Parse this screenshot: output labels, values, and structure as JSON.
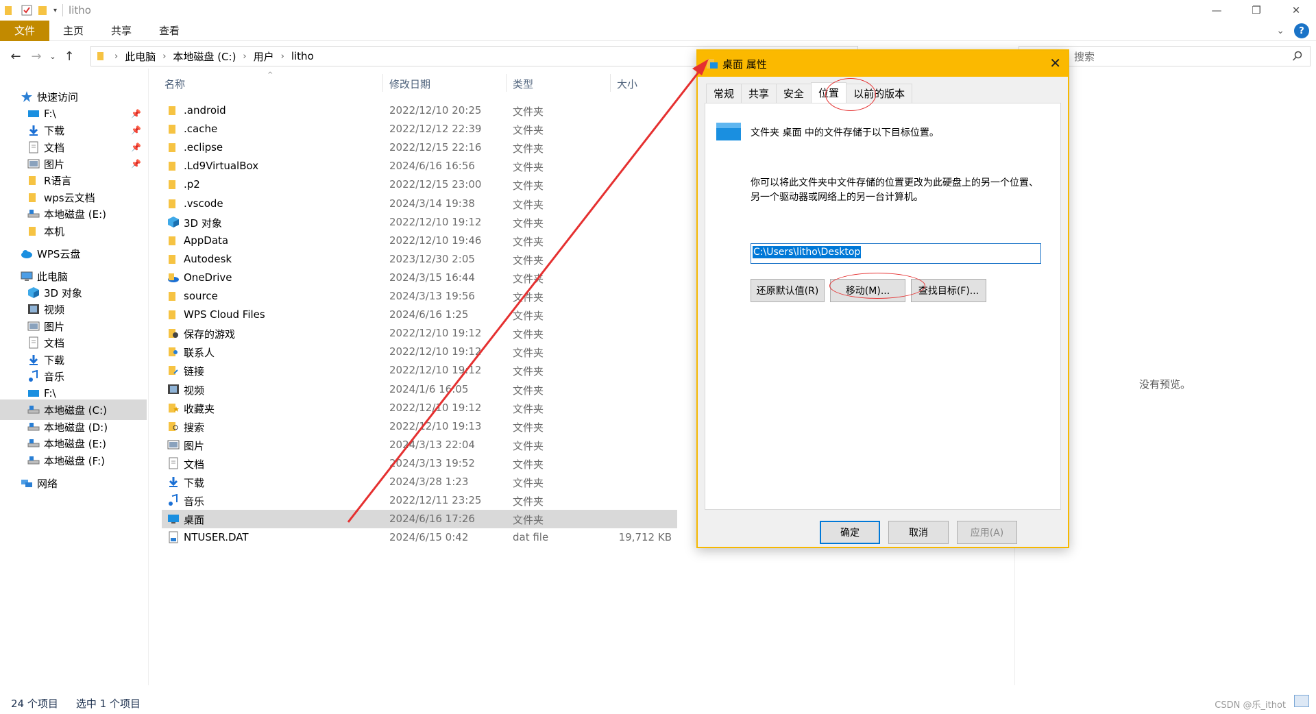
{
  "titlebar": {
    "title": "litho"
  },
  "ribbon": {
    "tabs": [
      "文件",
      "主页",
      "共享",
      "查看"
    ]
  },
  "address": {
    "crumbs": [
      "此电脑",
      "本地磁盘 (C:)",
      "用户",
      "litho"
    ],
    "search_placeholder": "搜索"
  },
  "sidebar": {
    "items": [
      {
        "label": "快速访问",
        "icon": "star-icon",
        "indent": 0,
        "pinned": false
      },
      {
        "label": "F:\\",
        "icon": "drive-icon",
        "indent": 1,
        "pinned": true
      },
      {
        "label": "下载",
        "icon": "download-icon",
        "indent": 1,
        "pinned": true
      },
      {
        "label": "文档",
        "icon": "document-icon",
        "indent": 1,
        "pinned": true
      },
      {
        "label": "图片",
        "icon": "picture-icon",
        "indent": 1,
        "pinned": true
      },
      {
        "label": "R语言",
        "icon": "folder-icon",
        "indent": 1,
        "pinned": false
      },
      {
        "label": "wps云文档",
        "icon": "folder-icon",
        "indent": 1,
        "pinned": false
      },
      {
        "label": "本地磁盘 (E:)",
        "icon": "disk-icon",
        "indent": 1,
        "pinned": false
      },
      {
        "label": "本机",
        "icon": "folder-icon",
        "indent": 1,
        "pinned": false
      },
      {
        "label": "WPS云盘",
        "icon": "cloud-icon",
        "indent": 0,
        "pinned": false
      },
      {
        "label": "此电脑",
        "icon": "computer-icon",
        "indent": 0,
        "pinned": false
      },
      {
        "label": "3D 对象",
        "icon": "3d-icon",
        "indent": 1,
        "pinned": false
      },
      {
        "label": "视频",
        "icon": "video-icon",
        "indent": 1,
        "pinned": false
      },
      {
        "label": "图片",
        "icon": "picture-icon",
        "indent": 1,
        "pinned": false
      },
      {
        "label": "文档",
        "icon": "document-icon",
        "indent": 1,
        "pinned": false
      },
      {
        "label": "下载",
        "icon": "download-icon",
        "indent": 1,
        "pinned": false
      },
      {
        "label": "音乐",
        "icon": "music-icon",
        "indent": 1,
        "pinned": false
      },
      {
        "label": "F:\\",
        "icon": "drive-icon",
        "indent": 1,
        "pinned": false
      },
      {
        "label": "本地磁盘 (C:)",
        "icon": "disk-icon",
        "indent": 1,
        "pinned": false,
        "selected": true
      },
      {
        "label": "本地磁盘 (D:)",
        "icon": "disk-icon",
        "indent": 1,
        "pinned": false
      },
      {
        "label": "本地磁盘 (E:)",
        "icon": "disk-icon",
        "indent": 1,
        "pinned": false
      },
      {
        "label": "本地磁盘 (F:)",
        "icon": "disk-icon",
        "indent": 1,
        "pinned": false
      },
      {
        "label": "网络",
        "icon": "network-icon",
        "indent": 0,
        "pinned": false
      }
    ]
  },
  "columns": {
    "name": "名称",
    "date": "修改日期",
    "type": "类型",
    "size": "大小"
  },
  "files": [
    {
      "name": ".android",
      "date": "2022/12/10 20:25",
      "type": "文件夹",
      "size": "",
      "icon": "folder-icon"
    },
    {
      "name": ".cache",
      "date": "2022/12/12 22:39",
      "type": "文件夹",
      "size": "",
      "icon": "folder-icon"
    },
    {
      "name": ".eclipse",
      "date": "2022/12/15 22:16",
      "type": "文件夹",
      "size": "",
      "icon": "folder-icon"
    },
    {
      "name": ".Ld9VirtualBox",
      "date": "2024/6/16 16:56",
      "type": "文件夹",
      "size": "",
      "icon": "folder-icon"
    },
    {
      "name": ".p2",
      "date": "2022/12/15 23:00",
      "type": "文件夹",
      "size": "",
      "icon": "folder-icon"
    },
    {
      "name": ".vscode",
      "date": "2024/3/14 19:38",
      "type": "文件夹",
      "size": "",
      "icon": "folder-icon"
    },
    {
      "name": "3D 对象",
      "date": "2022/12/10 19:12",
      "type": "文件夹",
      "size": "",
      "icon": "3d-icon"
    },
    {
      "name": "AppData",
      "date": "2022/12/10 19:46",
      "type": "文件夹",
      "size": "",
      "icon": "folder-icon"
    },
    {
      "name": "Autodesk",
      "date": "2023/12/30 2:05",
      "type": "文件夹",
      "size": "",
      "icon": "folder-icon"
    },
    {
      "name": "OneDrive",
      "date": "2024/3/15 16:44",
      "type": "文件夹",
      "size": "",
      "icon": "onedrive-icon"
    },
    {
      "name": "source",
      "date": "2024/3/13 19:56",
      "type": "文件夹",
      "size": "",
      "icon": "folder-icon"
    },
    {
      "name": "WPS Cloud Files",
      "date": "2024/6/16 1:25",
      "type": "文件夹",
      "size": "",
      "icon": "folder-icon"
    },
    {
      "name": "保存的游戏",
      "date": "2022/12/10 19:12",
      "type": "文件夹",
      "size": "",
      "icon": "game-icon"
    },
    {
      "name": "联系人",
      "date": "2022/12/10 19:12",
      "type": "文件夹",
      "size": "",
      "icon": "contacts-icon"
    },
    {
      "name": "链接",
      "date": "2022/12/10 19:12",
      "type": "文件夹",
      "size": "",
      "icon": "link-icon"
    },
    {
      "name": "视频",
      "date": "2024/1/6 16:05",
      "type": "文件夹",
      "size": "",
      "icon": "video-icon"
    },
    {
      "name": "收藏夹",
      "date": "2022/12/10 19:12",
      "type": "文件夹",
      "size": "",
      "icon": "favorites-icon"
    },
    {
      "name": "搜索",
      "date": "2022/12/10 19:13",
      "type": "文件夹",
      "size": "",
      "icon": "search-folder-icon"
    },
    {
      "name": "图片",
      "date": "2024/3/13 22:04",
      "type": "文件夹",
      "size": "",
      "icon": "picture-icon"
    },
    {
      "name": "文档",
      "date": "2024/3/13 19:52",
      "type": "文件夹",
      "size": "",
      "icon": "document-icon"
    },
    {
      "name": "下载",
      "date": "2024/3/28 1:23",
      "type": "文件夹",
      "size": "",
      "icon": "download-icon"
    },
    {
      "name": "音乐",
      "date": "2022/12/11 23:25",
      "type": "文件夹",
      "size": "",
      "icon": "music-icon"
    },
    {
      "name": "桌面",
      "date": "2024/6/16 17:26",
      "type": "文件夹",
      "size": "",
      "icon": "desktop-icon",
      "selected": true
    },
    {
      "name": "NTUSER.DAT",
      "date": "2024/6/15 0:42",
      "type": "dat file",
      "size": "19,712 KB",
      "icon": "file-icon"
    }
  ],
  "preview": {
    "text": "没有预览。"
  },
  "status": {
    "count": "24 个项目",
    "selected": "选中 1 个项目"
  },
  "watermark": "CSDN @乐_ithot",
  "dialog": {
    "title": "桌面 属性",
    "tabs": [
      "常规",
      "共享",
      "安全",
      "位置",
      "以前的版本"
    ],
    "active_tab": "位置",
    "line1": "文件夹 桌面 中的文件存储于以下目标位置。",
    "paragraph": "你可以将此文件夹中文件存储的位置更改为此硬盘上的另一个位置、另一个驱动器或网络上的另一台计算机。",
    "path": "C:\\Users\\litho\\Desktop",
    "btn_restore": "还原默认值(R)",
    "btn_move": "移动(M)...",
    "btn_find": "查找目标(F)...",
    "btn_ok": "确定",
    "btn_cancel": "取消",
    "btn_apply": "应用(A)"
  },
  "colors": {
    "accent_file_tab": "#c28a00",
    "dialog_title": "#fbb900",
    "selection": "#d9d9d9",
    "annotation_red": "#e53030",
    "link_blue": "#0078d7"
  }
}
